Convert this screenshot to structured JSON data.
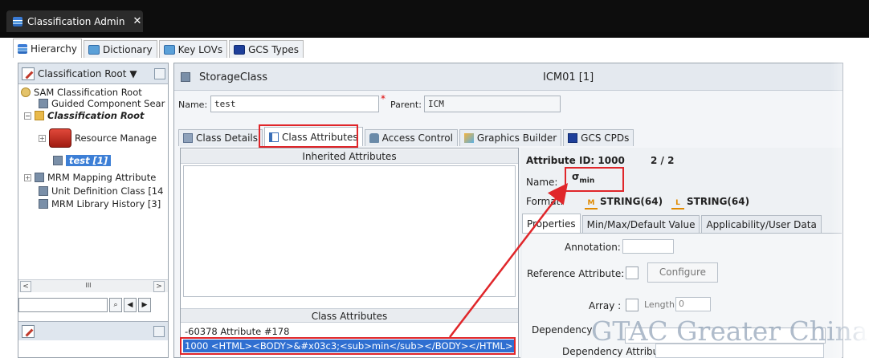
{
  "app": {
    "tab_title": "Classification Admin",
    "close_glyph": "✕"
  },
  "top_tabs": [
    {
      "label": "Hierarchy",
      "icon": "hierarchy-icon",
      "active": true
    },
    {
      "label": "Dictionary",
      "icon": "dictionary-icon",
      "active": false
    },
    {
      "label": "Key LOVs",
      "icon": "key-lovs-icon",
      "active": false
    },
    {
      "label": "GCS Types",
      "icon": "gcs-types-icon",
      "active": false
    }
  ],
  "tree": {
    "root_selector": "Classification Root",
    "items": [
      "SAM Classification Root",
      "Guided Component Sear",
      "Classification Root",
      "Resource Manage",
      "test  [1]",
      "MRM Mapping Attribute",
      "Unit Definition Class  [14",
      "MRM Library History  [3]"
    ],
    "scroll_thumb": "III"
  },
  "header": {
    "class_name": "StorageClass",
    "class_id": "ICM01 [1]"
  },
  "form": {
    "name_label": "Name:",
    "name_value": "test",
    "parent_label": "Parent:",
    "parent_value": "ICM",
    "required_glyph": "*"
  },
  "sub_tabs": [
    {
      "label": "Class Details",
      "active": false
    },
    {
      "label": "Class Attributes",
      "active": true
    },
    {
      "label": "Access Control",
      "active": false
    },
    {
      "label": "Graphics Builder",
      "active": false
    },
    {
      "label": "GCS CPDs",
      "active": false
    }
  ],
  "inherited": {
    "title": "Inherited Attributes"
  },
  "class_attributes": {
    "title": "Class Attributes",
    "rows": [
      "-60378  Attribute #178",
      "1000  <HTML><BODY>&#x03c3;<sub>min</sub></BODY></HTML>"
    ]
  },
  "detail": {
    "attr_id_label": "Attribute ID:",
    "attr_id_value": "1000",
    "attr_count": "2 / 2",
    "name_label": "Name:",
    "name_symbol": "σ",
    "name_subscript": "min",
    "format_label": "Format:",
    "format_1": "STRING(64)",
    "format_1_icon": "M",
    "format_2": "STRING(64)",
    "format_2_icon": "L"
  },
  "prop_tabs": [
    {
      "label": "Properties",
      "active": true
    },
    {
      "label": "Min/Max/Default Value",
      "active": false
    },
    {
      "label": "Applicability/User Data",
      "active": false
    }
  ],
  "properties": {
    "annotation_label": "Annotation:",
    "reference_label": "Reference Attribute:",
    "configure_label": "Configure",
    "array_label": "Array :",
    "length_label": "Length:",
    "length_value": "0",
    "dependency_label": "Dependency",
    "dependency_attr_label": "Dependency Attribute"
  },
  "watermark": "GTAC Greater China",
  "colors": {
    "highlight_red": "#e0262a",
    "selection_blue": "#2f6fd1",
    "arrow_red": "#e0262a"
  }
}
